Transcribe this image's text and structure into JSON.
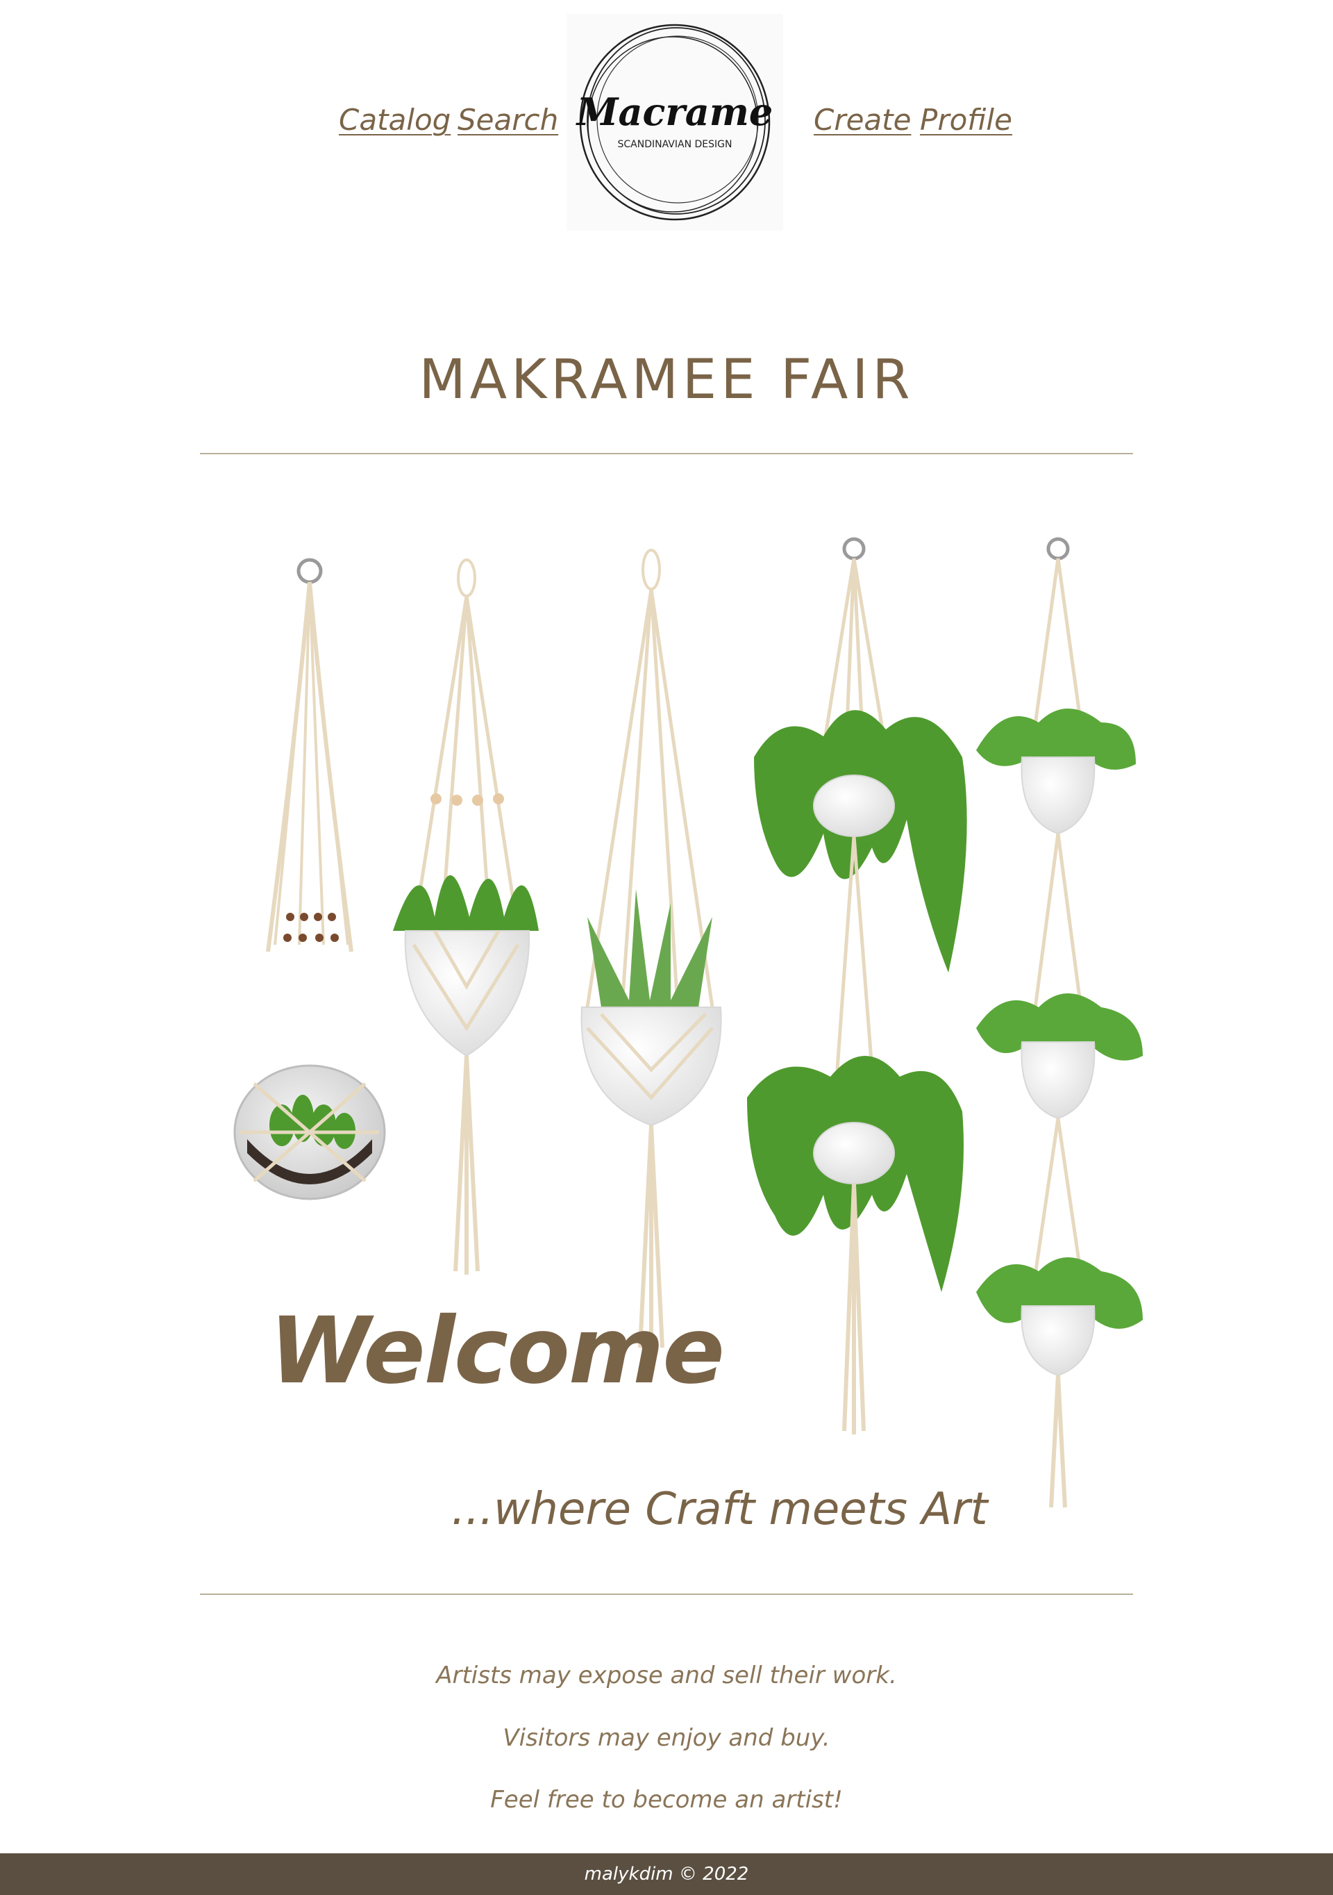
{
  "nav": {
    "catalog": "Catalog",
    "search": "Search",
    "create": "Create",
    "profile": "Profile"
  },
  "logo": {
    "name": "Macrame",
    "subtitle": "SCANDINAVIAN DESIGN"
  },
  "title": "MAKRAMEE FAIR",
  "hero": {
    "welcome": "Welcome",
    "tagline": "...where Craft meets Art",
    "image": "hanging-macrame-planters"
  },
  "info": [
    "Artists may expose and sell their work.",
    "Visitors may enjoy and buy.",
    "Feel free to become an artist!"
  ],
  "footer": {
    "text": "malykdim © 2022"
  },
  "colors": {
    "accent_text": "#7a6448",
    "divider": "#b7b09a",
    "footer_bg": "#5a4f41",
    "cord": "#e8dcc4",
    "leaf": "#4f9a2e"
  }
}
